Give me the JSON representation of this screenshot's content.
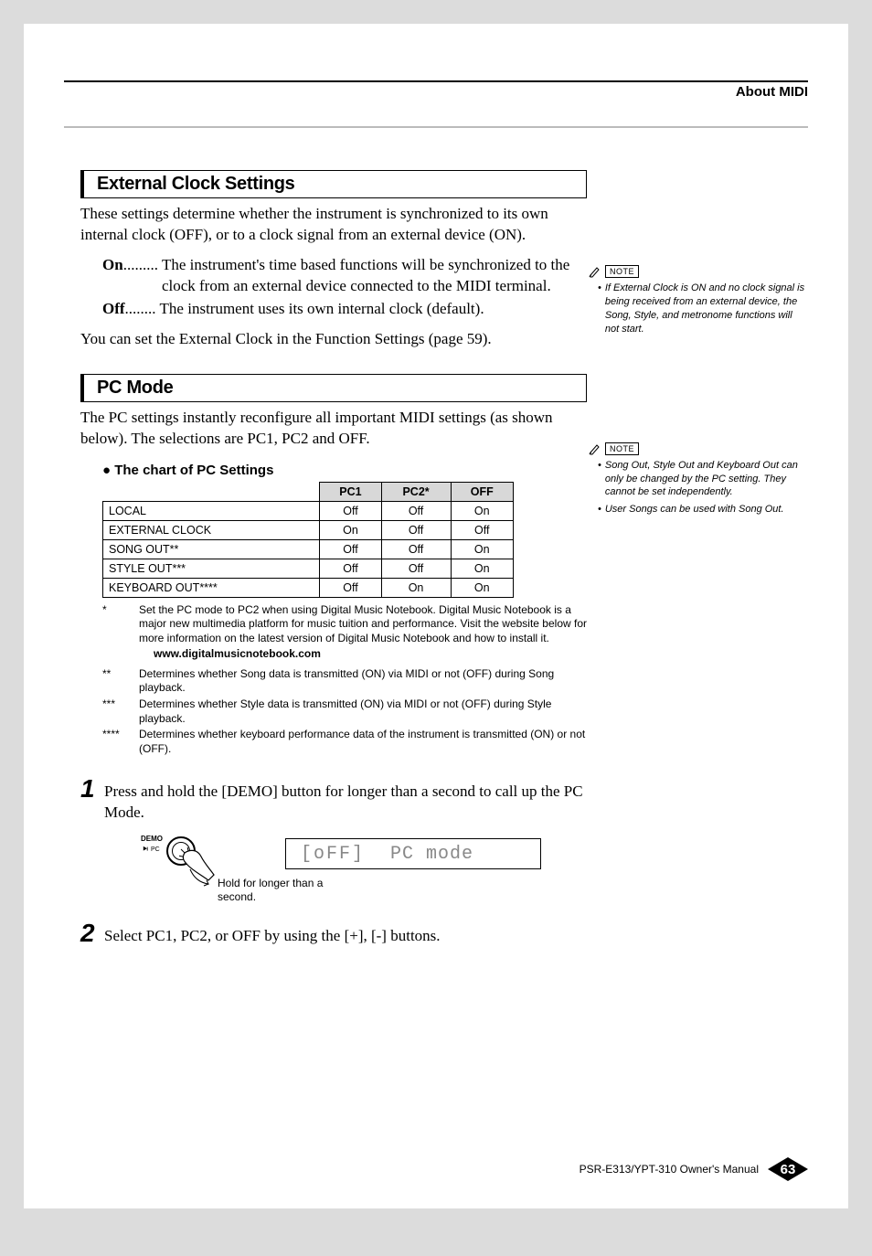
{
  "header": {
    "title": "About MIDI"
  },
  "sections": {
    "ecs": {
      "heading": "External Clock Settings",
      "intro": "These settings determine whether the instrument is synchronized to its own internal clock (OFF), or to a clock signal from an external device (ON).",
      "defs": {
        "on": {
          "term": "On",
          "dots": ".........",
          "desc": "The instrument's time based functions will be synchronized to the clock from an external device connected to the MIDI terminal."
        },
        "off": {
          "term": "Off",
          "dots": "........",
          "desc": "The instrument uses its own internal clock (default)."
        }
      },
      "outro": "You can set the External Clock in the Function Settings (page 59)."
    },
    "pcmode": {
      "heading": "PC Mode",
      "intro": "The PC settings instantly reconfigure all important MIDI settings (as shown below). The selections are PC1, PC2 and OFF.",
      "chart_title": "The chart of PC Settings"
    }
  },
  "chart_data": {
    "type": "table",
    "columns": [
      "",
      "PC1",
      "PC2*",
      "OFF"
    ],
    "rows": [
      {
        "label": "LOCAL",
        "pc1": "Off",
        "pc2": "Off",
        "off": "On"
      },
      {
        "label": "EXTERNAL CLOCK",
        "pc1": "On",
        "pc2": "Off",
        "off": "Off"
      },
      {
        "label": "SONG OUT**",
        "pc1": "Off",
        "pc2": "Off",
        "off": "On"
      },
      {
        "label": "STYLE OUT***",
        "pc1": "Off",
        "pc2": "Off",
        "off": "On"
      },
      {
        "label": "KEYBOARD OUT****",
        "pc1": "Off",
        "pc2": "On",
        "off": "On"
      }
    ]
  },
  "footnotes": {
    "f1": {
      "mark": "*",
      "text": "Set the PC mode to PC2 when using Digital Music Notebook. Digital Music Notebook is a major new multimedia platform for music tuition and performance. Visit the website below for more information on the latest version of Digital Music Notebook and how to install it."
    },
    "url": "www.digitalmusicnotebook.com",
    "f2": {
      "mark": "**",
      "text": "Determines whether Song data is transmitted (ON) via MIDI or not (OFF) during Song playback."
    },
    "f3": {
      "mark": "***",
      "text": "Determines whether Style data is transmitted (ON) via MIDI or not (OFF) during Style playback."
    },
    "f4": {
      "mark": "****",
      "text": "Determines whether keyboard performance data of the instrument is transmitted (ON) or not (OFF)."
    }
  },
  "steps": {
    "s1": {
      "num": "1",
      "text": "Press and hold the [DEMO] button for longer than a second to call up the PC Mode."
    },
    "s2": {
      "num": "2",
      "text": "Select PC1, PC2, or OFF by using the [+], [-] buttons."
    }
  },
  "illustration": {
    "demo_label": "DEMO",
    "pc_label": "PC",
    "hold_caption": "Hold for longer than a second.",
    "display_value": "[oFF]",
    "display_mode": "PC mode"
  },
  "notes": {
    "label": "NOTE",
    "n1": "If External Clock is ON and no clock signal is being received from an external device, the Song, Style, and metronome functions will not start.",
    "n2a": "Song Out, Style Out and Keyboard Out can only be changed by the PC setting. They cannot be set independently.",
    "n2b": "User Songs can be used with Song Out."
  },
  "footer": {
    "manual": "PSR-E313/YPT-310  Owner's Manual",
    "page": "63"
  }
}
